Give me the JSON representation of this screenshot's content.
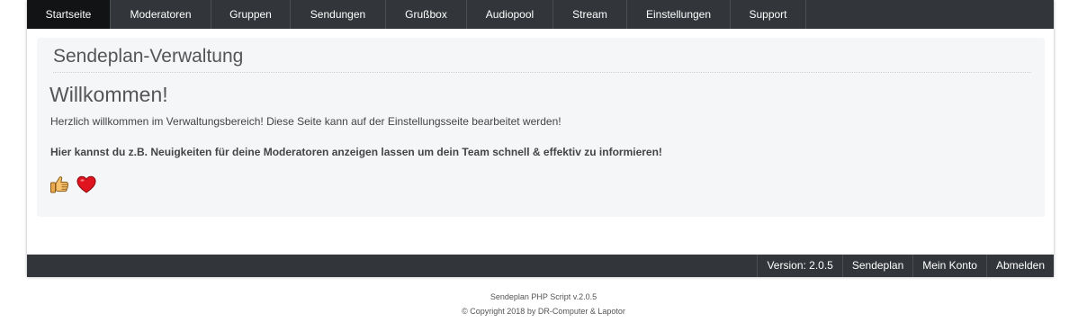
{
  "nav": {
    "items": [
      {
        "label": "Startseite",
        "active": true
      },
      {
        "label": "Moderatoren",
        "active": false
      },
      {
        "label": "Gruppen",
        "active": false
      },
      {
        "label": "Sendungen",
        "active": false
      },
      {
        "label": "Grußbox",
        "active": false
      },
      {
        "label": "Audiopool",
        "active": false
      },
      {
        "label": "Stream",
        "active": false
      },
      {
        "label": "Einstellungen",
        "active": false
      },
      {
        "label": "Support",
        "active": false
      }
    ]
  },
  "panel": {
    "title": "Sendeplan-Verwaltung",
    "heading": "Willkommen!",
    "intro": "Herzlich willkommen im Verwaltungsbereich! Diese Seite kann auf der Einstellungsseite bearbeitet werden!",
    "highlight": "Hier kannst du z.B. Neuigkeiten für deine Moderatoren anzeigen lassen um dein Team schnell & effektiv zu informieren!",
    "emojis": [
      "thumbs-up-icon",
      "heart-icon"
    ]
  },
  "footer_bar": {
    "version": "Version: 2.0.5",
    "sendeplan": "Sendeplan",
    "account": "Mein Konto",
    "logout": "Abmelden"
  },
  "copyright": {
    "line1": "Sendeplan PHP Script v.2.0.5",
    "line2": "© Copyright 2018 by DR-Computer & Lapotor"
  },
  "colors": {
    "nav_bg": "#32353a",
    "nav_active": "#121315",
    "panel_bg": "#f5f6f8",
    "heart": "#e0141e",
    "thumb": "#f5c26b"
  }
}
